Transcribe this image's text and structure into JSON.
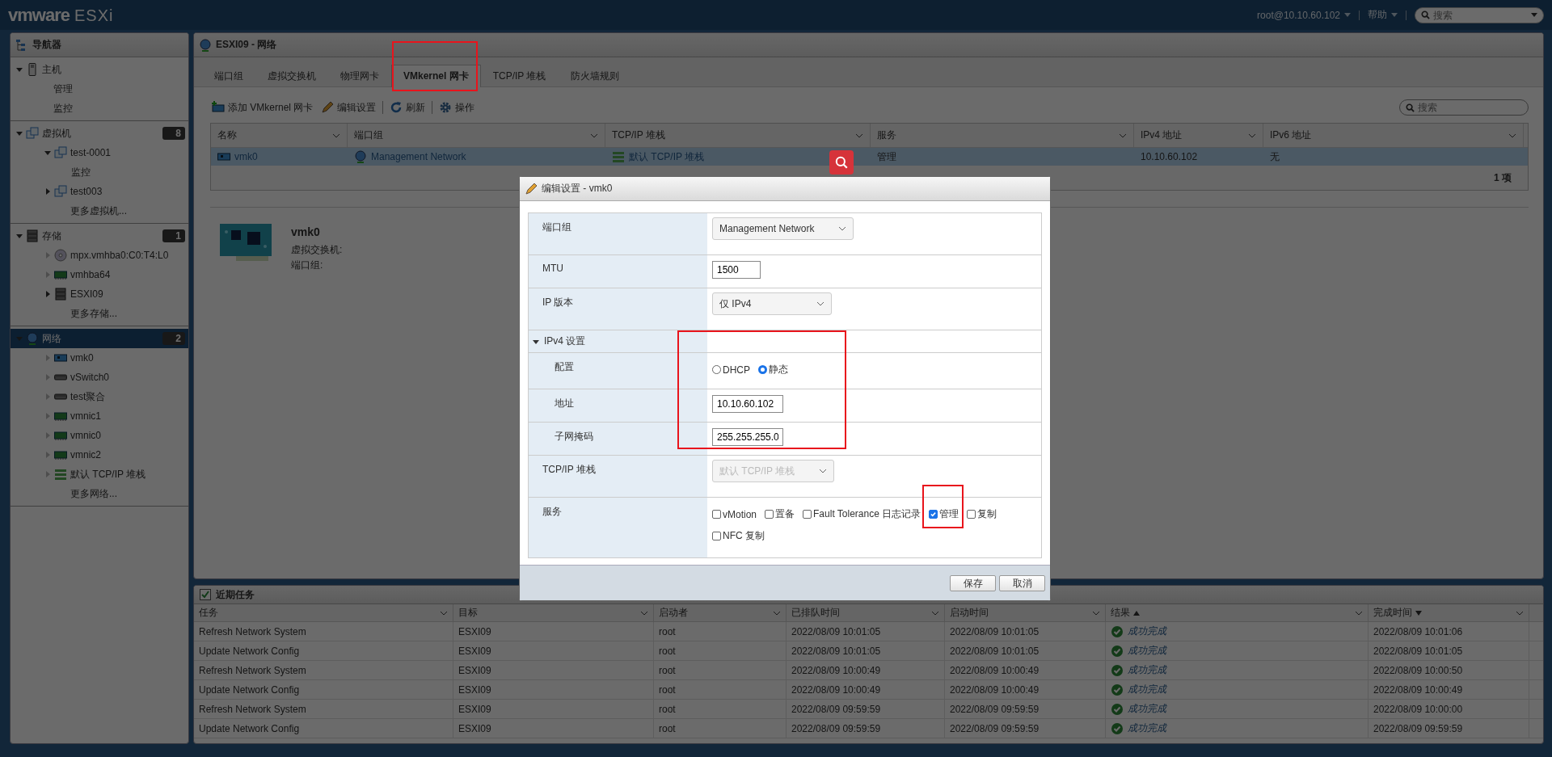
{
  "header": {
    "brand": "vmware",
    "product": "ESXi",
    "user": "root@10.10.60.102",
    "help": "帮助",
    "search": {
      "placeholder": "搜索"
    }
  },
  "navigator": {
    "title": "导航器",
    "sections": [
      {
        "label": "主机",
        "kind": "host",
        "expanded": true,
        "selected": false,
        "children": [
          {
            "label": "管理",
            "kind": "page"
          },
          {
            "label": "监控",
            "kind": "page"
          }
        ]
      },
      {
        "label": "虚拟机",
        "kind": "vms",
        "expanded": true,
        "selected": false,
        "count": "8",
        "children": [
          {
            "label": "test-0001",
            "kind": "vm",
            "expanded": true,
            "disabled": false,
            "children": [
              {
                "label": "监控",
                "kind": "page"
              }
            ]
          },
          {
            "label": "test003",
            "kind": "vm",
            "expanded": false,
            "disabled": false
          },
          {
            "label": "更多虚拟机...",
            "kind": "more"
          }
        ]
      },
      {
        "label": "存储",
        "kind": "storage",
        "expanded": true,
        "selected": false,
        "count": "1",
        "children": [
          {
            "label": "mpx.vmhba0:C0:T4:L0",
            "kind": "cdrom",
            "expanded": false,
            "disabled": true
          },
          {
            "label": "vmhba64",
            "kind": "hba",
            "expanded": false,
            "disabled": true
          },
          {
            "label": "ESXI09",
            "kind": "datastore",
            "expanded": false,
            "disabled": false
          },
          {
            "label": "更多存储...",
            "kind": "more"
          }
        ]
      },
      {
        "label": "网络",
        "kind": "network",
        "expanded": true,
        "selected": true,
        "count": "2",
        "children": [
          {
            "label": "vmk0",
            "kind": "vmk",
            "expanded": false,
            "disabled": true
          },
          {
            "label": "vSwitch0",
            "kind": "vswitch",
            "expanded": false,
            "disabled": true
          },
          {
            "label": "test聚合",
            "kind": "vswitch",
            "expanded": false,
            "disabled": true
          },
          {
            "label": "vmnic1",
            "kind": "hba",
            "expanded": false,
            "disabled": true
          },
          {
            "label": "vmnic0",
            "kind": "hba",
            "expanded": false,
            "disabled": true
          },
          {
            "label": "vmnic2",
            "kind": "hba",
            "expanded": false,
            "disabled": true
          },
          {
            "label": "默认 TCP/IP 堆栈",
            "kind": "stack",
            "expanded": false,
            "disabled": true
          },
          {
            "label": "更多网络...",
            "kind": "more"
          }
        ]
      }
    ]
  },
  "main": {
    "title": "ESXI09 - 网络",
    "tabs": [
      {
        "label": "端口组",
        "selected": false
      },
      {
        "label": "虚拟交换机",
        "selected": false
      },
      {
        "label": "物理网卡",
        "selected": false
      },
      {
        "label": "VMkernel 网卡",
        "selected": true
      },
      {
        "label": "TCP/IP 堆栈",
        "selected": false
      },
      {
        "label": "防火墙规则",
        "selected": false
      }
    ],
    "toolbar": [
      {
        "label": "添加 VMkernel 网卡",
        "kind": "add"
      },
      {
        "label": "编辑设置",
        "kind": "edit"
      },
      {
        "label": "刷新",
        "kind": "refresh"
      },
      {
        "label": "操作",
        "kind": "actions"
      }
    ],
    "search": {
      "placeholder": "搜索"
    },
    "table": {
      "columns": [
        "名称",
        "端口组",
        "TCP/IP 堆栈",
        "服务",
        "IPv4 地址",
        "IPv6 地址"
      ],
      "rows": [
        {
          "selected": true,
          "cells": [
            {
              "text": "vmk0",
              "kind": "vmk"
            },
            {
              "text": "Management Network",
              "kind": "network"
            },
            {
              "text": "默认 TCP/IP 堆栈",
              "kind": "stack"
            },
            {
              "text": "管理"
            },
            {
              "text": "10.10.60.102"
            },
            {
              "text": "无"
            }
          ]
        }
      ],
      "footer": "1 项"
    },
    "detail": {
      "name": "vmk0",
      "fields": [
        "虚拟交换机:",
        "端口组:"
      ]
    }
  },
  "dialog": {
    "title": "编辑设置 - vmk0",
    "rows": [
      {
        "label": "端口组",
        "kind": "select",
        "value": "Management Network",
        "disabled": false
      },
      {
        "label": "MTU",
        "kind": "text",
        "value": "1500"
      },
      {
        "label": "IP 版本",
        "kind": "select",
        "value": "仅 IPv4",
        "disabled": false
      },
      {
        "label": "IPv4 设置",
        "kind": "section",
        "expanded": true,
        "children": [
          {
            "label": "配置",
            "kind": "radio",
            "options": [
              {
                "label": "DHCP",
                "selected": false
              },
              {
                "label": "静态",
                "selected": true
              }
            ]
          },
          {
            "label": "地址",
            "kind": "text",
            "value": "10.10.60.102"
          },
          {
            "label": "子网掩码",
            "kind": "text",
            "value": "255.255.255.0"
          }
        ]
      },
      {
        "label": "TCP/IP 堆栈",
        "kind": "select",
        "value": "默认 TCP/IP 堆栈",
        "disabled": true
      },
      {
        "label": "服务",
        "kind": "checks",
        "options": [
          {
            "label": "vMotion",
            "checked": false
          },
          {
            "label": "置备",
            "checked": false
          },
          {
            "label": "Fault Tolerance 日志记录",
            "checked": false
          },
          {
            "label": "管理",
            "checked": true
          },
          {
            "label": "复制",
            "checked": false
          },
          {
            "label": "NFC 复制",
            "checked": false
          }
        ]
      }
    ],
    "buttons": [
      "保存",
      "取消"
    ]
  },
  "tasks": {
    "title": "近期任务",
    "columns": [
      {
        "label": "任务",
        "sorted": false
      },
      {
        "label": "目标",
        "sorted": false
      },
      {
        "label": "启动者",
        "sorted": false
      },
      {
        "label": "已排队时间",
        "sorted": false
      },
      {
        "label": "启动时间",
        "sorted": false
      },
      {
        "label": "结果",
        "sorted": true,
        "descending": false
      },
      {
        "label": "完成时间",
        "sorted": true,
        "descending": true
      }
    ],
    "rows": [
      {
        "task": "Refresh Network System",
        "target": "ESXI09",
        "initiator": "root",
        "queued": "2022/08/09 10:01:05",
        "started": "2022/08/09 10:01:05",
        "result": {
          "text": "成功完成",
          "success": true
        },
        "completed": "2022/08/09 10:01:06"
      },
      {
        "task": "Update Network Config",
        "target": "ESXI09",
        "initiator": "root",
        "queued": "2022/08/09 10:01:05",
        "started": "2022/08/09 10:01:05",
        "result": {
          "text": "成功完成",
          "success": true
        },
        "completed": "2022/08/09 10:01:05"
      },
      {
        "task": "Refresh Network System",
        "target": "ESXI09",
        "initiator": "root",
        "queued": "2022/08/09 10:00:49",
        "started": "2022/08/09 10:00:49",
        "result": {
          "text": "成功完成",
          "success": true
        },
        "completed": "2022/08/09 10:00:50"
      },
      {
        "task": "Update Network Config",
        "target": "ESXI09",
        "initiator": "root",
        "queued": "2022/08/09 10:00:49",
        "started": "2022/08/09 10:00:49",
        "result": {
          "text": "成功完成",
          "success": true
        },
        "completed": "2022/08/09 10:00:49"
      },
      {
        "task": "Refresh Network System",
        "target": "ESXI09",
        "initiator": "root",
        "queued": "2022/08/09 09:59:59",
        "started": "2022/08/09 09:59:59",
        "result": {
          "text": "成功完成",
          "success": true
        },
        "completed": "2022/08/09 10:00:00"
      },
      {
        "task": "Update Network Config",
        "target": "ESXI09",
        "initiator": "root",
        "queued": "2022/08/09 09:59:59",
        "started": "2022/08/09 09:59:59",
        "result": {
          "text": "成功完成",
          "success": true
        },
        "completed": "2022/08/09 09:59:59"
      }
    ]
  }
}
